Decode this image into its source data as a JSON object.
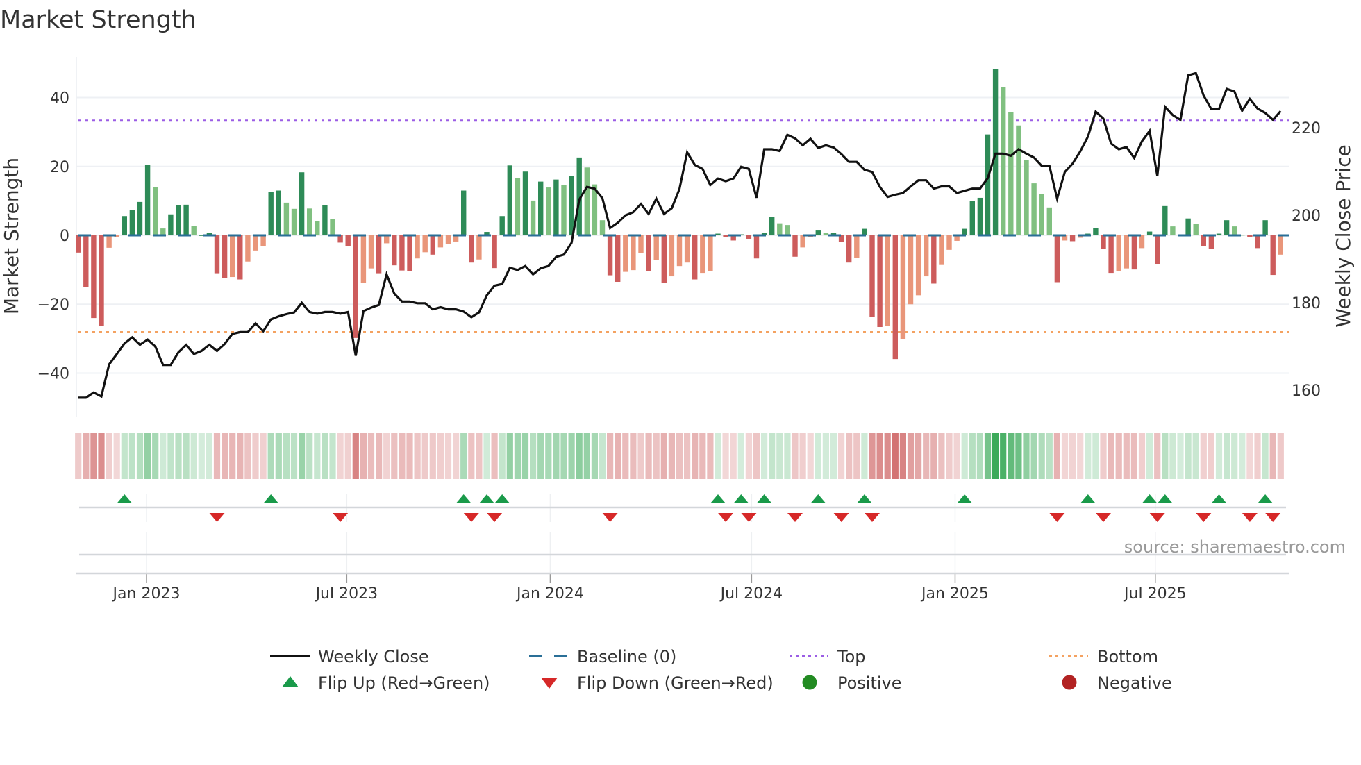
{
  "chart_data": {
    "type": "bar",
    "title": "Market Strength",
    "ylabel": "Market Strength",
    "y2label": "Weekly Close Price",
    "ylim": [
      -52.6,
      51.8
    ],
    "y2lim": [
      154,
      236.2
    ],
    "yticks": [
      40,
      20,
      0,
      -20,
      -40
    ],
    "y2ticks": [
      220,
      200,
      180,
      160
    ],
    "yticklabels": [
      "40",
      "20",
      "0",
      "−20",
      "−40"
    ],
    "y2ticklabels": [
      "220",
      "200",
      "180",
      "160"
    ],
    "x_start_week": "2022-10-31",
    "x_interval_days": 7,
    "xticks": [
      {
        "date": "2023-01-01",
        "label": "Jan 2023"
      },
      {
        "date": "2023-07-01",
        "label": "Jul 2023"
      },
      {
        "date": "2024-01-01",
        "label": "Jan 2024"
      },
      {
        "date": "2024-07-01",
        "label": "Jul 2024"
      },
      {
        "date": "2025-01-01",
        "label": "Jan 2025"
      },
      {
        "date": "2025-07-01",
        "label": "Jul 2025"
      }
    ],
    "top_level": 33.3,
    "bottom_level": -28.1,
    "baseline": 0,
    "strength": [
      -5,
      -15,
      -24,
      -26.3,
      -3.6,
      -0.5,
      5.6,
      7.3,
      9.7,
      20.4,
      14,
      2,
      6.1,
      8.7,
      8.9,
      2.7,
      0,
      0.7,
      -11,
      -12.3,
      -12.1,
      -12.8,
      -7.6,
      -4.4,
      -3.2,
      12.6,
      13,
      9.5,
      7.7,
      18.3,
      7.8,
      4.1,
      8.7,
      4.7,
      -2.1,
      -3.2,
      -29.8,
      -13.8,
      -9.6,
      -11,
      -2.3,
      -8.7,
      -10.2,
      -10.4,
      -6.7,
      -4.9,
      -5.6,
      -3.5,
      -2.5,
      -1.8,
      13,
      -7.9,
      -7,
      1,
      -9.5,
      5.6,
      20.3,
      16.7,
      18.5,
      10.1,
      15.6,
      13.9,
      16.2,
      14.6,
      17.3,
      22.6,
      19.7,
      14.8,
      4.4,
      -11.6,
      -13.5,
      -10.6,
      -10.1,
      -5.2,
      -10.3,
      -7.2,
      -13.9,
      -11.9,
      -8.9,
      -7.9,
      -12.8,
      -10.9,
      -10.4,
      0.5,
      -0.5,
      -1.5,
      0.3,
      -1,
      -6.7,
      0.7,
      5.3,
      3.5,
      3,
      -6.2,
      -3.5,
      -0.6,
      1.4,
      0.7,
      0.7,
      -2,
      -7.9,
      -6.6,
      1.9,
      -23.6,
      -26.6,
      -26.2,
      -35.9,
      -30.2,
      -20,
      -17.4,
      -11.9,
      -14,
      -8.6,
      -4.2,
      -1.6,
      1.9,
      9.9,
      10.9,
      29.3,
      48.2,
      43,
      35.7,
      31.9,
      21.8,
      15.1,
      11.9,
      8.1,
      -13.6,
      -1.5,
      -1.7,
      -0.7,
      0.5,
      2.1,
      -4,
      -10.9,
      -10.4,
      -9.6,
      -9.9,
      -3.7,
      1.1,
      -8.4,
      8.5,
      2.6,
      0.2,
      4.9,
      3.4,
      -3.2,
      -3.9,
      0.5,
      4.4,
      2.6,
      0.1,
      -0.6,
      -3.7,
      4.4,
      -11.5,
      -5.6
    ],
    "weekly_close": [
      158.3,
      158.3,
      159.5,
      158.6,
      165.9,
      168.3,
      170.7,
      172.1,
      170.4,
      171.6,
      170,
      165.8,
      165.8,
      168.7,
      170.4,
      168.3,
      169,
      170.4,
      169,
      170.6,
      172.9,
      173.3,
      173.3,
      175.3,
      173.5,
      176.2,
      176.9,
      177.4,
      177.8,
      180,
      177.9,
      177.5,
      177.9,
      177.9,
      177.5,
      177.9,
      167.9,
      178.1,
      178.9,
      179.5,
      186.5,
      182.1,
      180.3,
      180.3,
      179.9,
      179.9,
      178.5,
      179,
      178.5,
      178.5,
      178,
      176.7,
      177.8,
      181.7,
      183.9,
      184.3,
      188,
      187.5,
      188.4,
      186.5,
      187.9,
      188.4,
      190.5,
      191,
      193.7,
      203.6,
      206.5,
      206.1,
      203.9,
      197.1,
      198.3,
      200,
      200.7,
      202.6,
      200.3,
      203.8,
      200.3,
      201.6,
      206,
      214.4,
      211.5,
      210.6,
      206.9,
      208.4,
      207.8,
      208.4,
      211.1,
      210.6,
      204,
      215.1,
      215.1,
      214.7,
      218.4,
      217.6,
      216,
      217.5,
      215.4,
      216,
      215.5,
      214,
      212.2,
      212.2,
      210.4,
      209.9,
      206.5,
      204.2,
      204.7,
      205.1,
      206.6,
      208,
      208,
      206.1,
      206.6,
      206.6,
      205.1,
      205.6,
      206.1,
      206.1,
      208.5,
      214.1,
      214.1,
      213.6,
      215.1,
      214.1,
      213.2,
      211.3,
      211.3,
      203.8,
      209.9,
      211.8,
      214.6,
      218,
      223.7,
      222.1,
      216.4,
      215.1,
      215.6,
      213.1,
      216.9,
      219.3,
      209,
      224.8,
      222.9,
      221.8,
      232,
      232.5,
      227.4,
      224.3,
      224.3,
      228.9,
      228.3,
      223.9,
      226.6,
      224.4,
      223.4,
      221.8,
      223.8
    ],
    "flip_up_weeks": [
      7,
      26,
      51,
      54,
      56,
      84,
      87,
      90,
      97,
      103,
      116,
      132,
      140,
      142,
      149,
      155
    ],
    "flip_down_weeks": [
      19,
      35,
      52,
      55,
      70,
      85,
      88,
      94,
      100,
      104,
      128,
      134,
      141,
      147,
      153,
      156
    ],
    "legend": {
      "placement": "bottom",
      "items": [
        {
          "key": "close",
          "label": "Weekly Close"
        },
        {
          "key": "baseline",
          "label": "Baseline (0)"
        },
        {
          "key": "top",
          "label": "Top"
        },
        {
          "key": "bottom",
          "label": "Bottom"
        },
        {
          "key": "flip_up",
          "label": "Flip Up (Red→Green)"
        },
        {
          "key": "flip_down",
          "label": "Flip Down (Green→Red)"
        },
        {
          "key": "positive",
          "label": "Positive"
        },
        {
          "key": "negative",
          "label": "Negative"
        }
      ]
    },
    "annotation": "source: sharemaestro.com",
    "grid": true
  },
  "colors": {
    "pos_strong": "#2e8b57",
    "pos_weak": "#80c080",
    "neg_strong": "#cd5c5c",
    "neg_weak": "#e9967a",
    "close": "#111111",
    "baseline": "#2a6f97",
    "top": "#9b5de5",
    "bottom": "#f4a261",
    "flip_up": "#1a9a4a",
    "flip_down": "#d62828",
    "positive": "#228b22",
    "negative": "#b22222"
  }
}
